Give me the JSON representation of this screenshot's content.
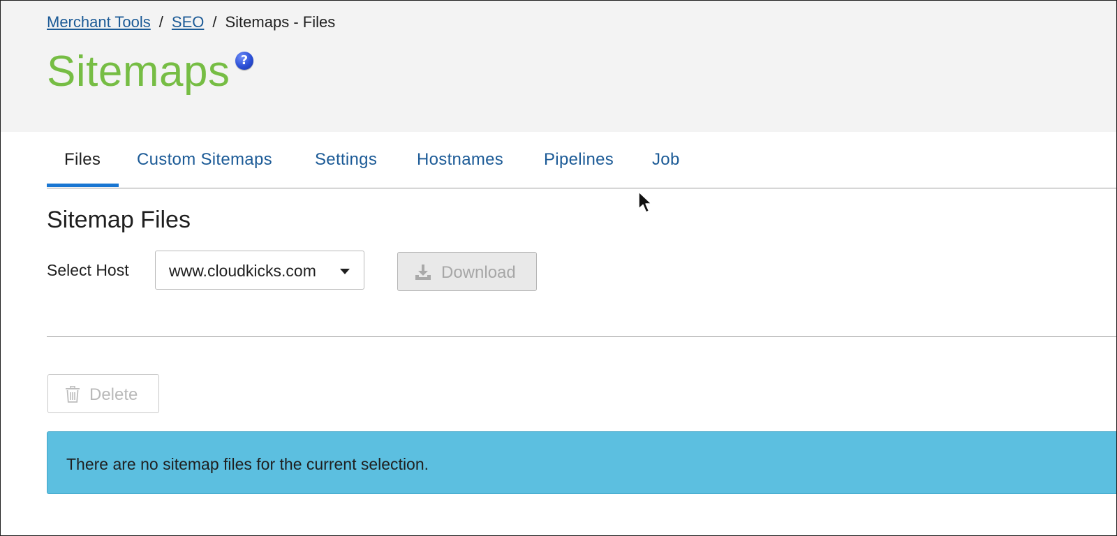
{
  "breadcrumb": {
    "items": [
      {
        "label": "Merchant Tools",
        "link": true
      },
      {
        "label": "SEO",
        "link": true
      },
      {
        "label": "Sitemaps - Files",
        "link": false
      }
    ],
    "separator": "/"
  },
  "page": {
    "title": "Sitemaps",
    "help_icon": "question-mark-icon"
  },
  "tabs": [
    {
      "label": "Files",
      "active": true
    },
    {
      "label": "Custom Sitemaps",
      "active": false
    },
    {
      "label": "Settings",
      "active": false
    },
    {
      "label": "Hostnames",
      "active": false
    },
    {
      "label": "Pipelines",
      "active": false
    },
    {
      "label": "Job",
      "active": false
    }
  ],
  "section": {
    "title": "Sitemap Files",
    "select_host_label": "Select Host",
    "host_select": {
      "value": "www.cloudkicks.com",
      "icon": "caret-down-icon"
    },
    "download_button": {
      "label": "Download",
      "icon": "download-icon",
      "disabled": true
    },
    "delete_button": {
      "label": "Delete",
      "icon": "trash-icon",
      "disabled": true
    },
    "empty_message": "There are no sitemap files for the current selection."
  },
  "colors": {
    "title_green": "#76bd44",
    "link_blue": "#1b5a96",
    "tab_active_underline": "#1976d2",
    "header_bg": "#f3f3f3",
    "info_banner_bg": "#5cbfe0",
    "disabled_text": "#a7a7a7"
  }
}
